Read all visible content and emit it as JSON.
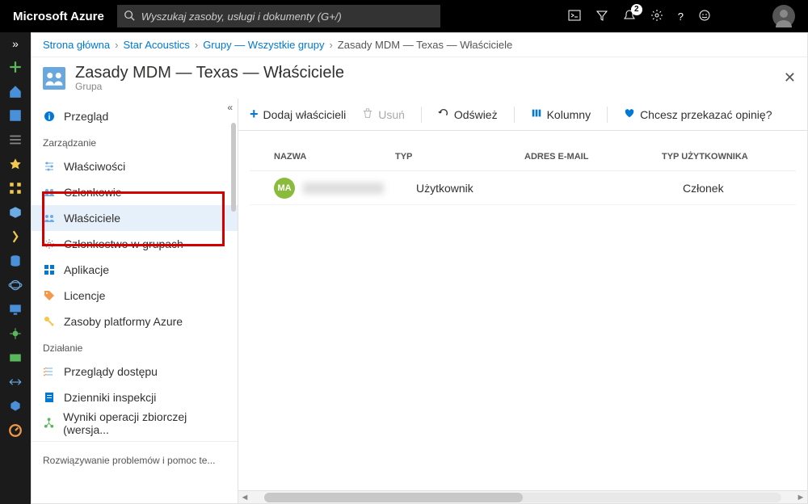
{
  "topbar": {
    "brand": "Microsoft Azure",
    "search_placeholder": "Wyszukaj zasoby, usługi i dokumenty (G+/)",
    "notification_count": "2"
  },
  "breadcrumb": {
    "items": [
      "Strona główna",
      "Star Acoustics",
      "Grupy — Wszystkie grupy"
    ],
    "current": "Zasady MDM — Texas — Właściciele"
  },
  "page": {
    "title": "Zasady MDM — Texas — Właściciele",
    "subtitle": "Grupa"
  },
  "side": {
    "overview": "Przegląd",
    "section_manage": "Zarządzanie",
    "items_manage": [
      "Właściwości",
      "Członkowie",
      "Właściciele",
      "Członkostwo w grupach",
      "Aplikacje",
      "Licencje",
      "Zasoby platformy Azure"
    ],
    "section_activity": "Działanie",
    "items_activity": [
      "Przeglądy dostępu",
      "Dzienniki inspekcji",
      "Wyniki operacji zbiorczej (wersja..."
    ],
    "section_troubleshoot": "Rozwiązywanie problemów i pomoc te..."
  },
  "toolbar": {
    "add": "Dodaj właścicieli",
    "remove": "Usuń",
    "refresh": "Odśwież",
    "columns": "Kolumny",
    "feedback": "Chcesz przekazać opinię?"
  },
  "table": {
    "headers": {
      "name": "NAZWA",
      "type": "TYP",
      "email": "ADRES E-MAIL",
      "utype": "TYP UŻYTKOWNIKA"
    },
    "rows": [
      {
        "avatar": "MA",
        "name": "",
        "type": "Użytkownik",
        "email": "",
        "utype": "Członek"
      }
    ]
  }
}
